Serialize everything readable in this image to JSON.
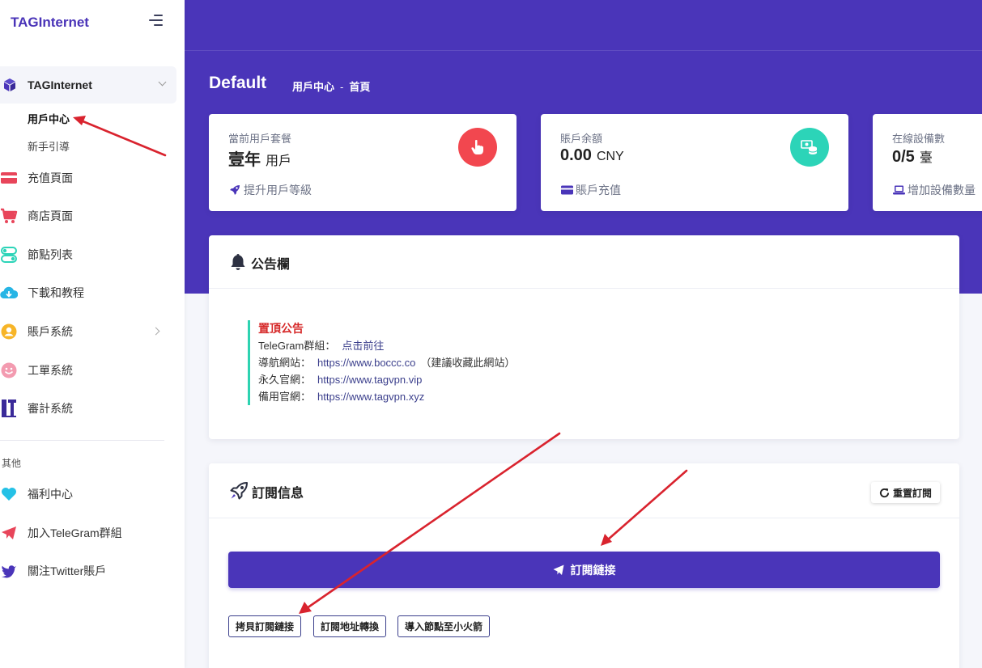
{
  "sidebar": {
    "brand": "TAGInternet",
    "group": {
      "label": "TAGInternet",
      "items": [
        "用戶中心",
        "新手引導"
      ],
      "active": "用戶中心"
    },
    "menu": [
      {
        "label": "充值頁面",
        "icon": "credit-card-icon"
      },
      {
        "label": "商店頁面",
        "icon": "shopping-cart-icon"
      },
      {
        "label": "節點列表",
        "icon": "toggles-icon"
      },
      {
        "label": "下載和教程",
        "icon": "cloud-download-icon"
      },
      {
        "label": "賬戶系統",
        "icon": "user-circle-icon"
      },
      {
        "label": "工單系統",
        "icon": "smile-icon"
      },
      {
        "label": "審計系統",
        "icon": "audit-icon"
      }
    ],
    "section_label": "其他",
    "other": [
      {
        "label": "福利中心",
        "icon": "heart-icon"
      },
      {
        "label": "加入TeleGram群組",
        "icon": "paper-plane-icon"
      },
      {
        "label": "關注Twitter賬戶",
        "icon": "twitter-icon"
      }
    ]
  },
  "header": {
    "title": "Default",
    "breadcrumb": [
      "用戶中心",
      "首頁"
    ],
    "separator": "-"
  },
  "stats": [
    {
      "label": "當前用戶套餐",
      "value": "壹年",
      "unit": "用戶",
      "link": "提升用戶等級",
      "badge_color": "#f2474f",
      "badge_icon": "pointer-hand-icon",
      "link_icon": "rocket-icon"
    },
    {
      "label": "賬戶余額",
      "value": "0.00",
      "unit": "CNY",
      "link": "賬戶充值",
      "badge_color": "#2cd4b8",
      "badge_icon": "money-coins-icon",
      "link_icon": "credit-card-icon"
    },
    {
      "label": "在線設備數",
      "value": "0/5",
      "unit": "臺",
      "link": "增加設備數量",
      "link_icon": "laptop-icon"
    }
  ],
  "announcement": {
    "title": "公告欄",
    "notice_title": "置頂公告",
    "rows": [
      {
        "label": "TeleGram群組：",
        "link": "点击前往",
        "extra": ""
      },
      {
        "label": "導航網站：",
        "link": "https://www.boccc.co",
        "extra": "（建議收藏此網站）"
      },
      {
        "label": "永久官網：",
        "link": "https://www.tagvpn.vip",
        "extra": ""
      },
      {
        "label": "備用官網：",
        "link": "https://www.tagvpn.xyz",
        "extra": ""
      }
    ]
  },
  "subscription": {
    "title": "訂閱信息",
    "reset_label": "重置訂閱",
    "main_button": "訂閱鏈接",
    "buttons": [
      "拷貝訂閱鏈接",
      "訂閱地址轉換",
      "導入節點至小火箭"
    ]
  },
  "colors": {
    "primary": "#4a35b9",
    "notice_accent": "#2dd3b1",
    "notice_title": "#d62a2a",
    "annotation_arrow": "#d9232e"
  }
}
